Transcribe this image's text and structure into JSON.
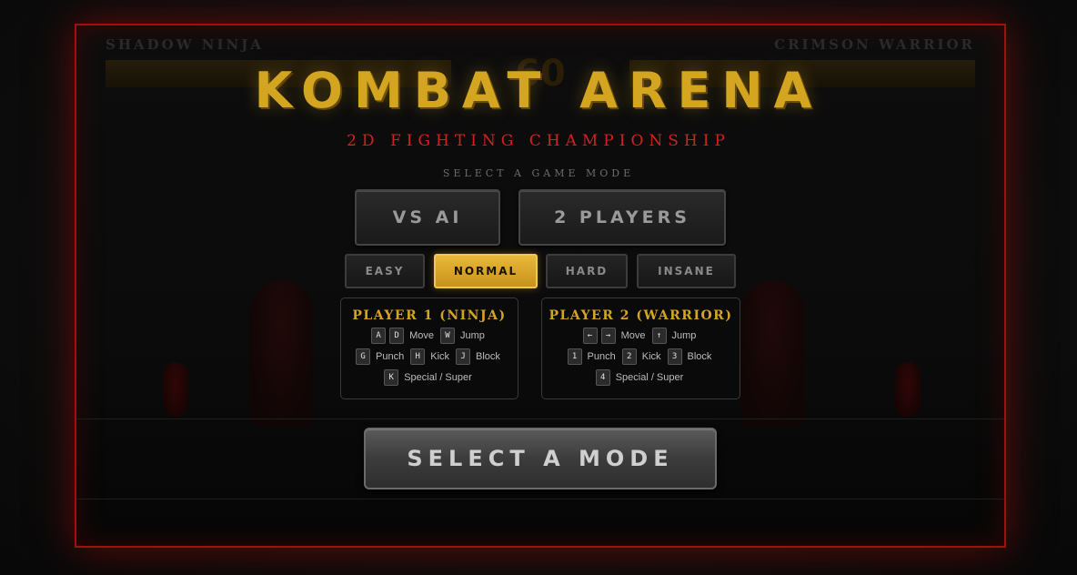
{
  "app": {
    "title": "KOMBAT ARENA",
    "subtitle": "2D FIGHTING CHAMPIONSHIP",
    "prompt": "SELECT A GAME MODE"
  },
  "background_hud": {
    "player1_name": "SHADOW NINJA",
    "player2_name": "CRIMSON WARRIOR",
    "timer": "60"
  },
  "modes": {
    "vs_ai": "VS AI",
    "two_players": "2 PLAYERS",
    "selected": ""
  },
  "difficulty": {
    "options": [
      "EASY",
      "NORMAL",
      "HARD",
      "INSANE"
    ],
    "selected": "NORMAL"
  },
  "controls": {
    "player1": {
      "title": "PLAYER 1 (NINJA)",
      "move_keys": [
        "A",
        "D"
      ],
      "move_label": "Move",
      "jump_key": "W",
      "jump_label": "Jump",
      "punch_key": "G",
      "punch_label": "Punch",
      "kick_key": "H",
      "kick_label": "Kick",
      "block_key": "J",
      "block_label": "Block",
      "special_key": "K",
      "special_label": "Special / Super"
    },
    "player2": {
      "title": "PLAYER 2 (WARRIOR)",
      "move_keys": [
        "←",
        "→"
      ],
      "move_label": "Move",
      "jump_key": "↑",
      "jump_label": "Jump",
      "punch_key": "1",
      "punch_label": "Punch",
      "kick_key": "2",
      "kick_label": "Kick",
      "block_key": "3",
      "block_label": "Block",
      "special_key": "4",
      "special_label": "Special / Super"
    }
  },
  "start_button": "SELECT A MODE",
  "colors": {
    "accent_gold": "#d4a520",
    "accent_red": "#d02222",
    "frame_red": "#a10f0f"
  }
}
